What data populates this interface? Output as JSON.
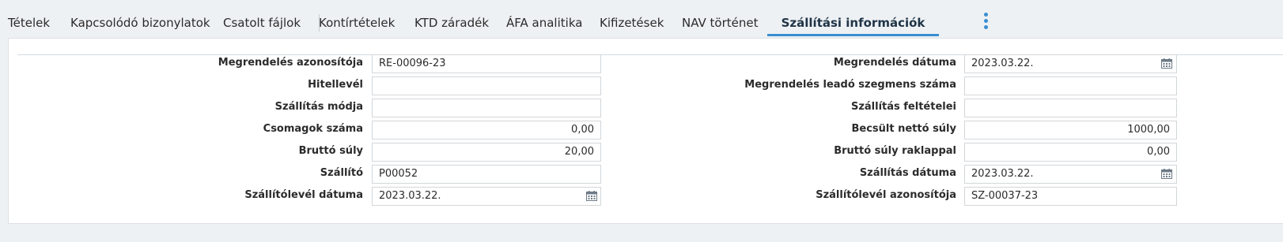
{
  "tabs": [
    {
      "label": "Tételek"
    },
    {
      "label": "Kapcsolódó bizonylatok"
    },
    {
      "label": "Csatolt fájlok"
    },
    {
      "label": "Kontírtételek"
    },
    {
      "label": "KTD záradék"
    },
    {
      "label": "ÁFA analitika"
    },
    {
      "label": "Kifizetések"
    },
    {
      "label": "NAV történet"
    },
    {
      "label": "Szállítási információk"
    }
  ],
  "active_tab": "Szállítási információk",
  "colors": {
    "accent": "#3a8ed1",
    "background": "#eef1f4",
    "panel": "#ffffff"
  },
  "icons": {
    "more": "vertical-ellipsis-icon",
    "calendar": "calendar-icon"
  },
  "form": {
    "left": [
      {
        "label": "Megrendelés azonosítója",
        "value": "RE-00096-23"
      },
      {
        "label": "Hitellevél",
        "value": ""
      },
      {
        "label": "Szállítás módja",
        "value": ""
      },
      {
        "label": "Csomagok száma",
        "value": "0,00"
      },
      {
        "label": "Bruttó súly",
        "value": "20,00"
      },
      {
        "label": "Szállító",
        "value": "P00052"
      },
      {
        "label": "Szállítólevél dátuma",
        "value": "2023.03.22."
      }
    ],
    "right": [
      {
        "label": "Megrendelés dátuma",
        "value": "2023.03.22."
      },
      {
        "label": "Megrendelés leadó szegmens száma",
        "value": ""
      },
      {
        "label": "Szállítás feltételei",
        "value": ""
      },
      {
        "label": "Becsült nettó súly",
        "value": "1000,00"
      },
      {
        "label": "Bruttó súly raklappal",
        "value": "0,00"
      },
      {
        "label": "Szállítás dátuma",
        "value": "2023.03.22."
      },
      {
        "label": "Szállítólevél azonosítója",
        "value": "SZ-00037-23"
      }
    ]
  }
}
